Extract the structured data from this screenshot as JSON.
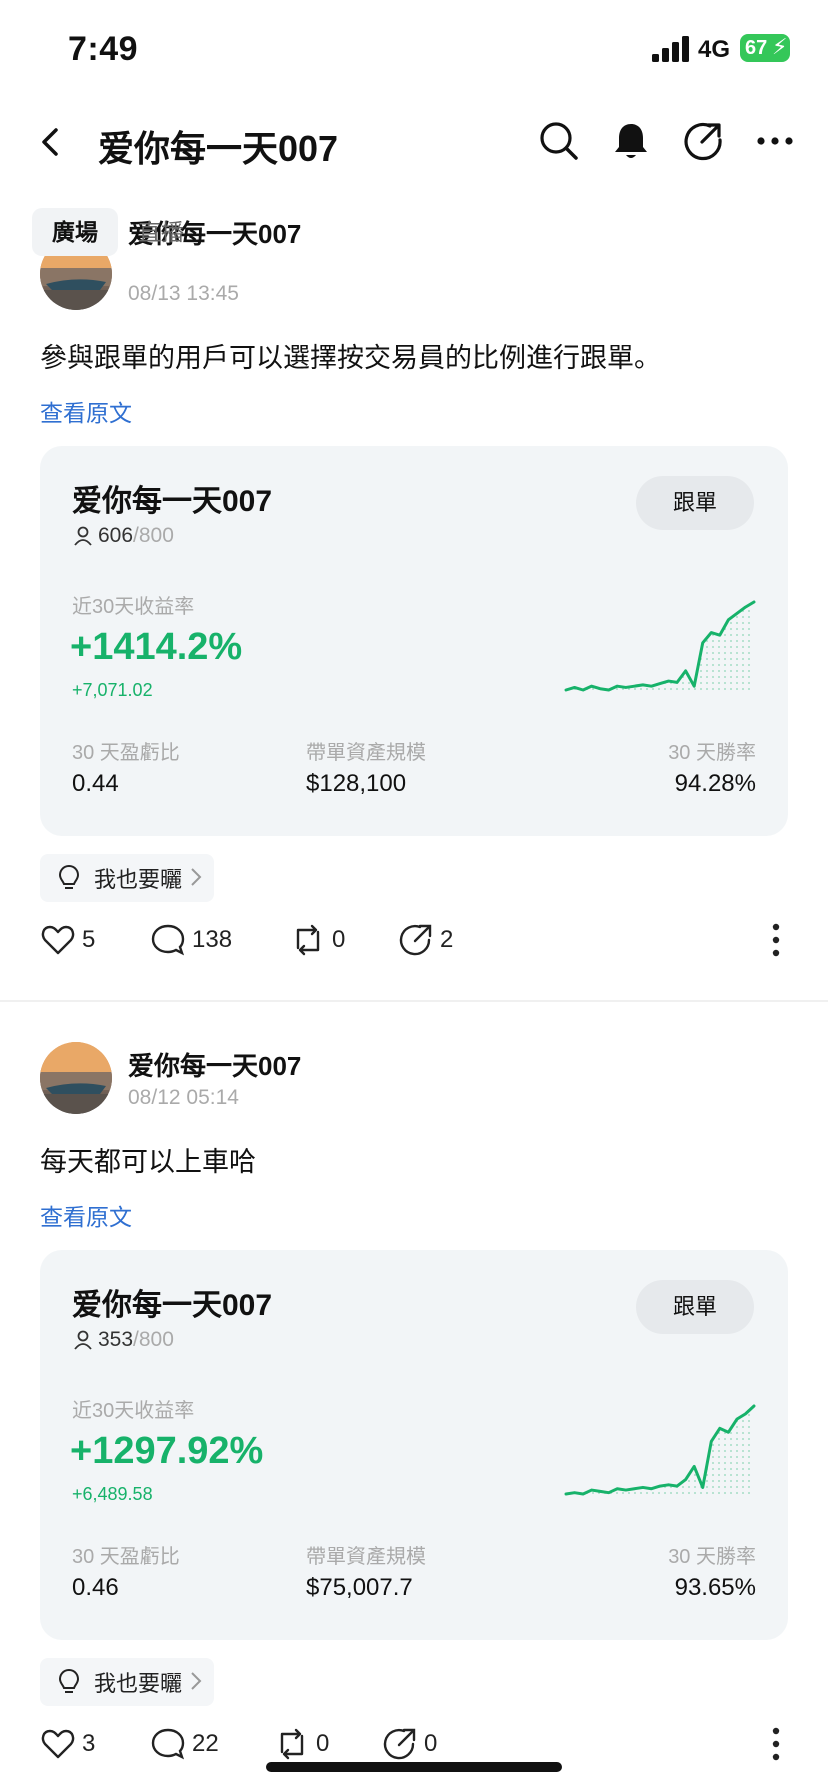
{
  "status_bar": {
    "time": "7:49",
    "network": "4G",
    "battery": "67"
  },
  "header": {
    "title": "爱你每一天007"
  },
  "tabs": [
    {
      "label": "廣場"
    },
    {
      "label": "直播"
    }
  ],
  "posts": [
    {
      "author": "爱你每一天007",
      "datetime": "08/13 13:45",
      "content": "參與跟單的用戶可以選擇按交易員的比例進行跟單。",
      "view_original": "查看原文",
      "card": {
        "trader": "爱你每一天007",
        "followers": "606",
        "followers_max": "/800",
        "follow_button": "跟單",
        "roi_label": "近30天收益率",
        "roi": "+1414.2%",
        "profit": "+7,071.02",
        "stats": [
          {
            "label": "30 天盈虧比",
            "value": "0.44"
          },
          {
            "label": "帶單資產規模",
            "value": "$128,100"
          },
          {
            "label": "30 天勝率",
            "value": "94.28%"
          }
        ],
        "sparkline": [
          5,
          7,
          5,
          8,
          6,
          5,
          8,
          7,
          8,
          9,
          8,
          10,
          12,
          11,
          20,
          8,
          42,
          50,
          48,
          60,
          65,
          70,
          74
        ]
      },
      "share_button": "我也要曬",
      "likes": "5",
      "comments": "138",
      "reposts": "0",
      "shares": "2"
    },
    {
      "author": "爱你每一天007",
      "datetime": "08/12 05:14",
      "content": "每天都可以上車哈",
      "view_original": "查看原文",
      "card": {
        "trader": "爱你每一天007",
        "followers": "353",
        "followers_max": "/800",
        "follow_button": "跟單",
        "roi_label": "近30天收益率",
        "roi": "+1297.92%",
        "profit": "+6,489.58",
        "stats": [
          {
            "label": "30 天盈虧比",
            "value": "0.46"
          },
          {
            "label": "帶單資產規模",
            "value": "$75,007.7"
          },
          {
            "label": "30 天勝率",
            "value": "93.65%"
          }
        ],
        "sparkline": [
          5,
          6,
          5,
          8,
          7,
          6,
          9,
          8,
          9,
          10,
          9,
          11,
          12,
          11,
          16,
          26,
          10,
          45,
          55,
          52,
          62,
          66,
          72
        ]
      },
      "share_button": "我也要曬",
      "likes": "3",
      "comments": "22",
      "reposts": "0",
      "shares": "0"
    }
  ],
  "colors": {
    "positive": "#17b26a",
    "link": "#2f6fd1",
    "battery": "#34c759"
  }
}
